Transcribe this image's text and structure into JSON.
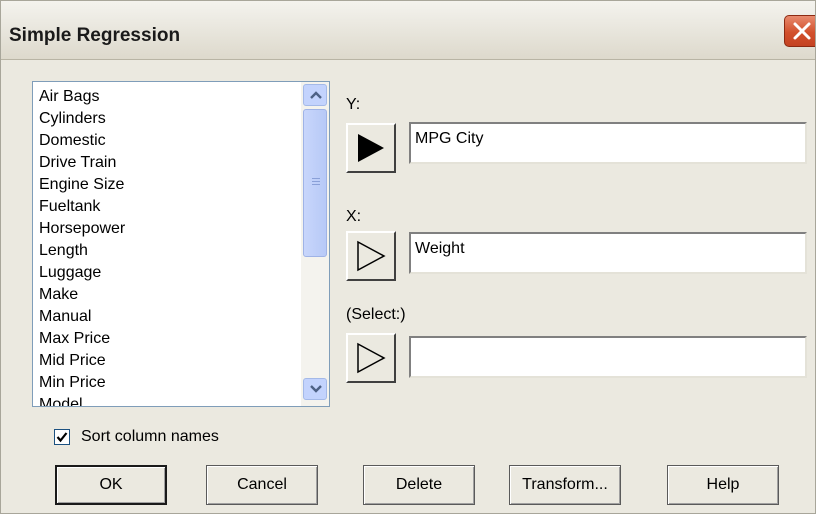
{
  "window": {
    "title": "Simple Regression"
  },
  "column_list": {
    "items": [
      "Air Bags",
      "Cylinders",
      "Domestic",
      "Drive Train",
      "Engine Size",
      "Fueltank",
      "Horsepower",
      "Length",
      "Luggage",
      "Make",
      "Manual",
      "Max Price",
      "Mid Price",
      "Min Price",
      "Model"
    ]
  },
  "fields": {
    "y": {
      "label": "Y:",
      "value": "MPG City"
    },
    "x": {
      "label": "X:",
      "value": "Weight"
    },
    "select": {
      "label": "(Select:)",
      "value": ""
    }
  },
  "options": {
    "sort_label": "Sort column names",
    "sort_checked": true
  },
  "buttons": {
    "ok": "OK",
    "cancel": "Cancel",
    "delete": "Delete",
    "transform": "Transform...",
    "help": "Help"
  },
  "icons": {
    "close": "close-icon",
    "scroll_up": "chevron-up-icon",
    "scroll_down": "chevron-down-icon",
    "arrow": "play-arrow-icon",
    "check": "check-icon"
  }
}
